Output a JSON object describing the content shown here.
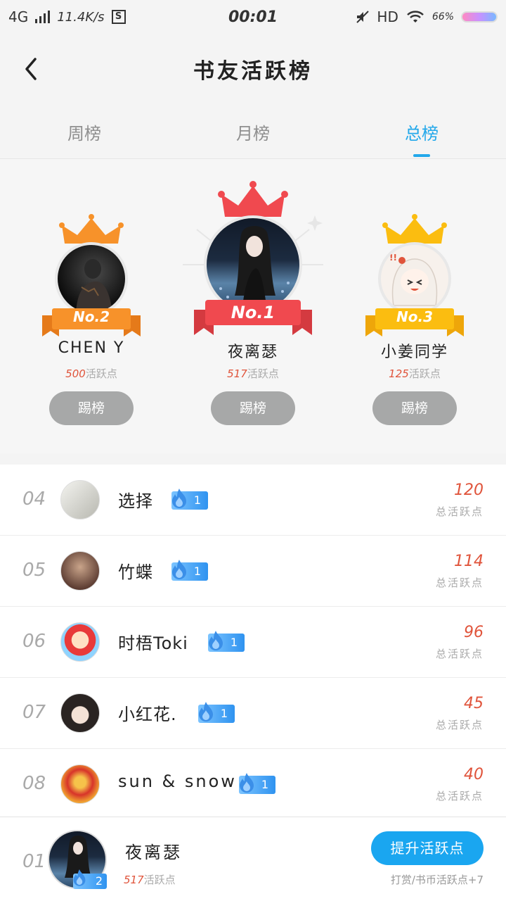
{
  "status_bar": {
    "network": "4G",
    "speed": "11.4K/s",
    "sim": "S",
    "time": "00:01",
    "hd": "HD",
    "battery": "66%"
  },
  "header": {
    "title": "书友活跃榜"
  },
  "tabs": [
    {
      "label": "周榜"
    },
    {
      "label": "月榜"
    },
    {
      "label": "总榜",
      "active": true
    }
  ],
  "podium": {
    "first": {
      "rank_label": "No.1",
      "name": "夜离瑟",
      "points": "517",
      "points_suffix": "活跃点",
      "button": "踢榜",
      "crown_color": "#f0494f"
    },
    "second": {
      "rank_label": "No.2",
      "name": "CHEN Y",
      "points": "500",
      "points_suffix": "活跃点",
      "button": "踢榜",
      "crown_color": "#f7922a"
    },
    "third": {
      "rank_label": "No.3",
      "name": "小姜同学",
      "points": "125",
      "points_suffix": "活跃点",
      "button": "踢榜",
      "crown_color": "#fbbd10"
    }
  },
  "list": [
    {
      "rank": "04",
      "name": "选择",
      "badge": "1",
      "value": "120",
      "label": "总活跃点"
    },
    {
      "rank": "05",
      "name": "竹蝶",
      "badge": "1",
      "value": "114",
      "label": "总活跃点"
    },
    {
      "rank": "06",
      "name": "时梧Toki",
      "badge": "1",
      "value": "96",
      "label": "总活跃点"
    },
    {
      "rank": "07",
      "name": "小红花.",
      "badge": "1",
      "value": "45",
      "label": "总活跃点"
    },
    {
      "rank": "08",
      "name": "sun & snow",
      "badge": "1",
      "value": "40",
      "label": "总活跃点"
    }
  ],
  "me": {
    "rank": "01",
    "name": "夜离瑟",
    "badge": "2",
    "points": "517",
    "points_suffix": "活跃点",
    "button": "提升活跃点",
    "hint": "打赏/书币活跃点+7"
  },
  "colors": {
    "accent": "#23a8ea",
    "value_red": "#e0543b",
    "button_gray": "#a7a8a8",
    "badge_blue": "#2f93f0"
  }
}
